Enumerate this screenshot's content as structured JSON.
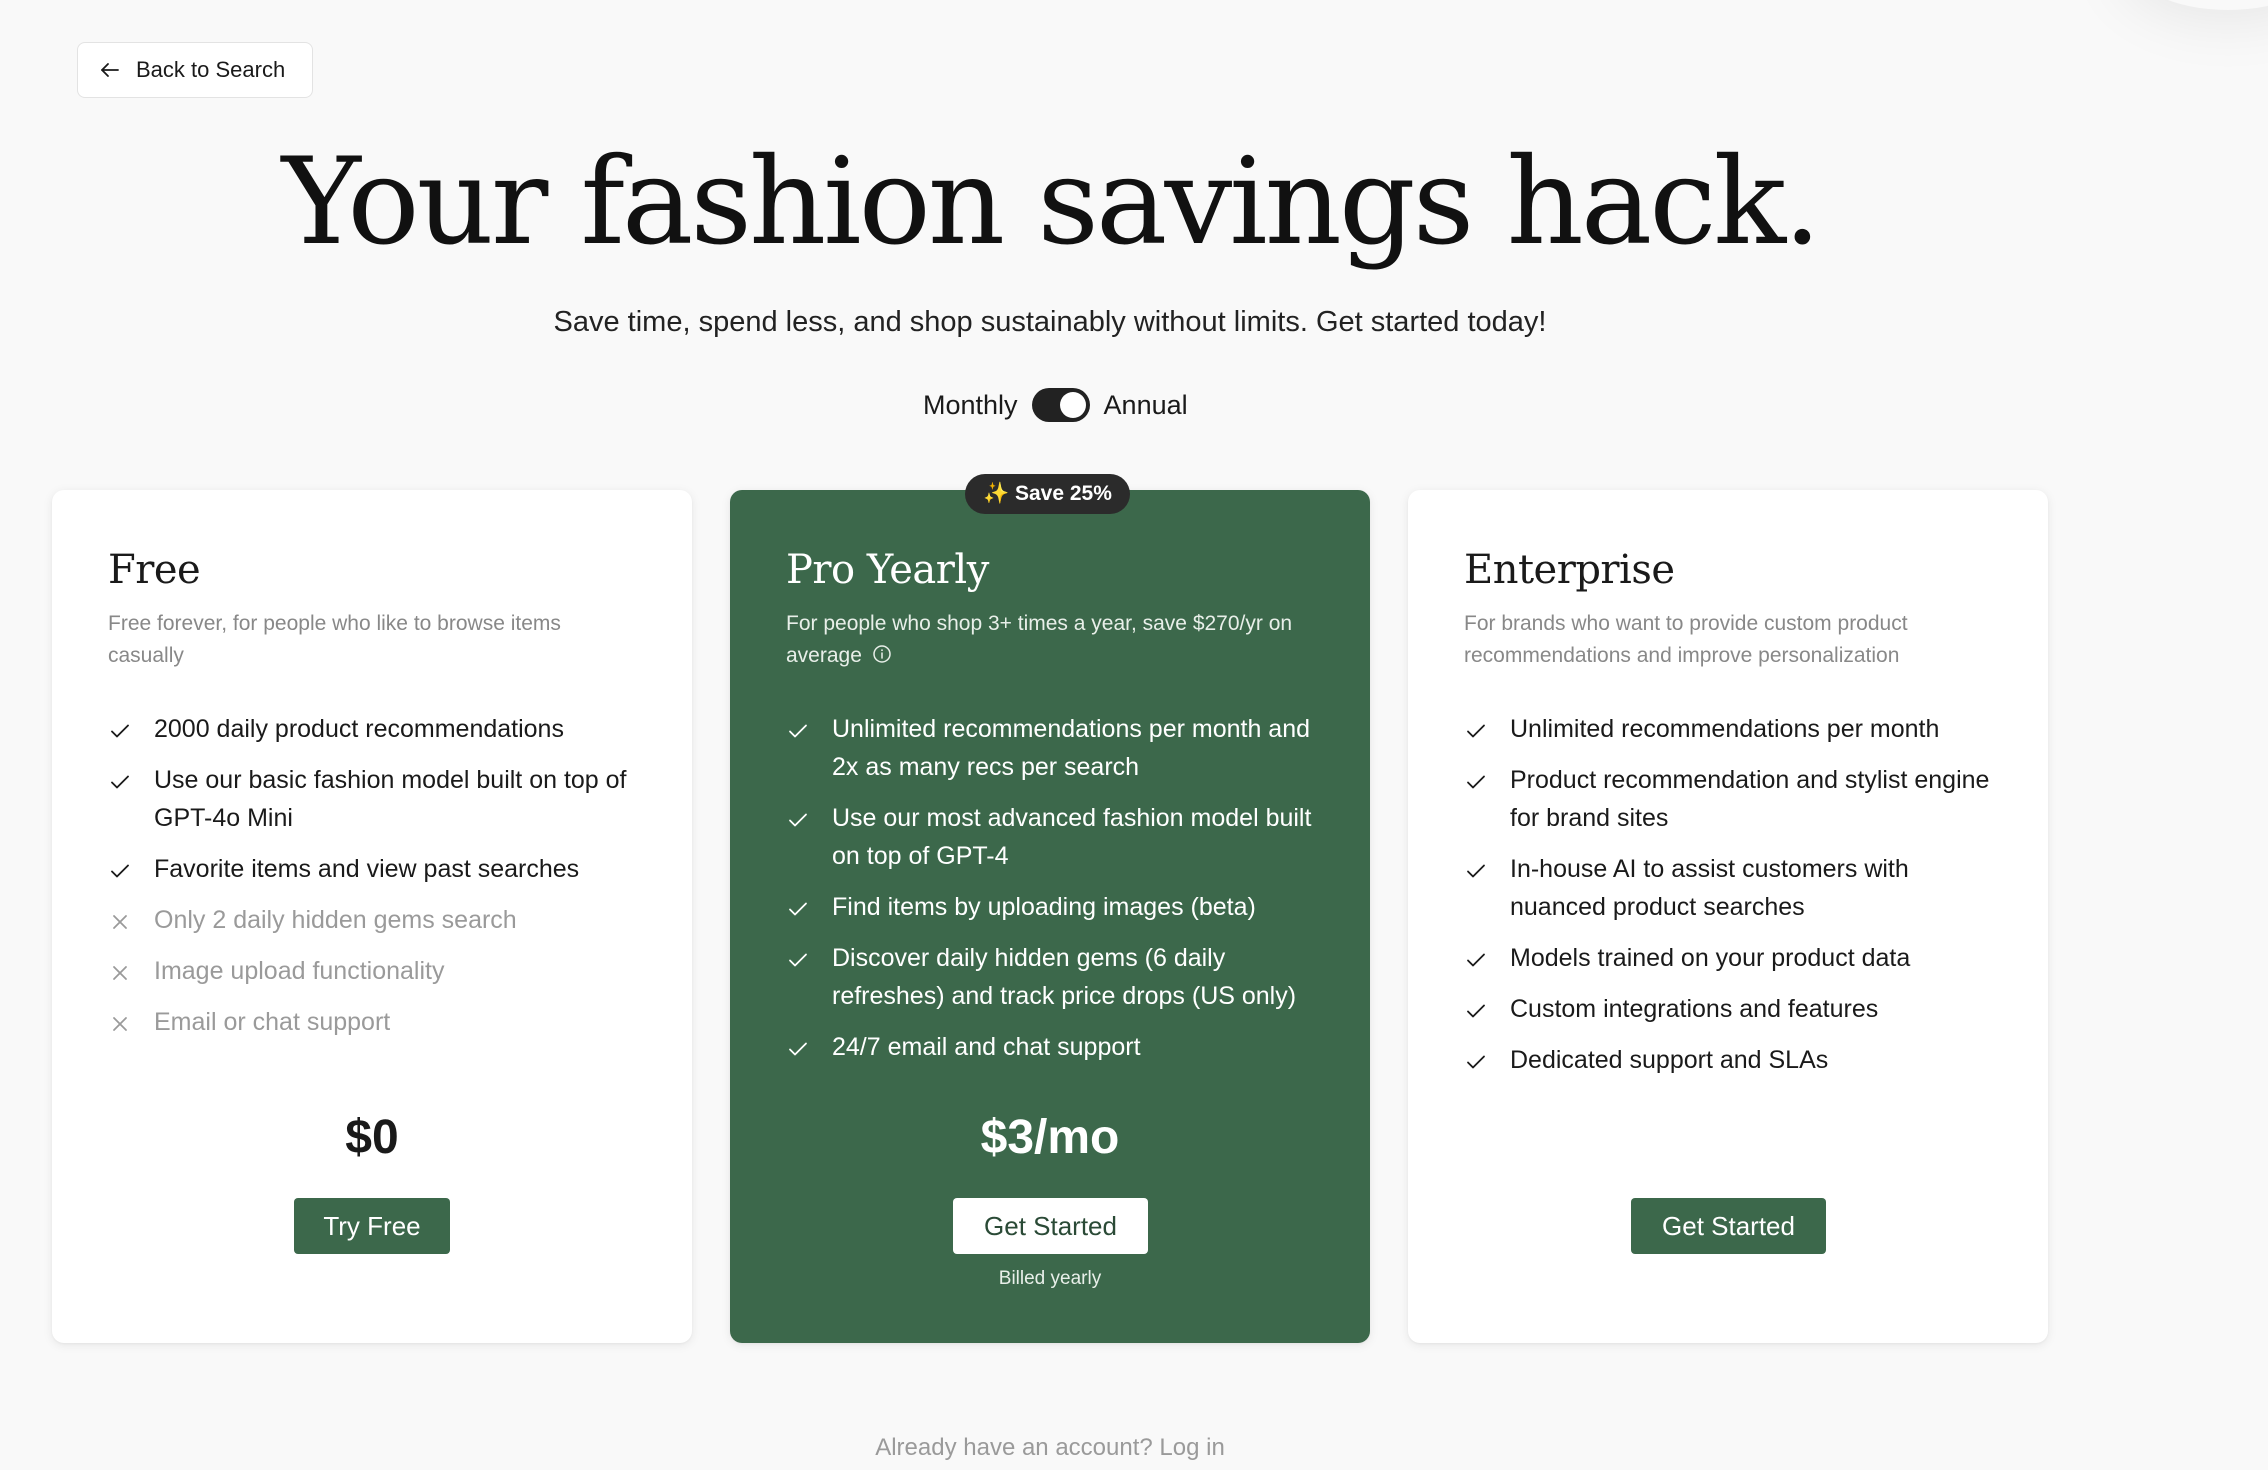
{
  "nav": {
    "back_label": "Back to Search"
  },
  "hero": {
    "title": "Your fashion savings hack.",
    "subtitle": "Save time, spend less, and shop sustainably without limits. Get started today!"
  },
  "billing": {
    "monthly_label": "Monthly",
    "annual_label": "Annual",
    "selected": "Annual"
  },
  "plans": [
    {
      "name": "Free",
      "description": "Free forever, for people who like to browse items casually",
      "features": [
        {
          "text": "2000 daily product recommendations",
          "included": true
        },
        {
          "text": "Use our basic fashion model built on top of GPT-4o Mini",
          "included": true
        },
        {
          "text": "Favorite items and view past searches",
          "included": true
        },
        {
          "text": "Only 2 daily hidden gems search",
          "included": false
        },
        {
          "text": "Image upload functionality",
          "included": false
        },
        {
          "text": "Email or chat support",
          "included": false
        }
      ],
      "price": "$0",
      "cta": "Try Free"
    },
    {
      "name": "Pro Yearly",
      "badge": "✨ Save 25%",
      "description": "For people who shop 3+ times a year, save $270/yr on average",
      "features": [
        {
          "text": "Unlimited recommendations per month and 2x as many recs per search",
          "included": true
        },
        {
          "text": "Use our most advanced fashion model built on top of GPT-4",
          "included": true
        },
        {
          "text": "Find items by uploading images (beta)",
          "included": true
        },
        {
          "text": "Discover daily hidden gems (6 daily refreshes) and track price drops (US only)",
          "included": true
        },
        {
          "text": "24/7 email and chat support",
          "included": true
        }
      ],
      "price": "$3/mo",
      "cta": "Get Started",
      "billing_note": "Billed yearly"
    },
    {
      "name": "Enterprise",
      "description": "For brands who want to provide custom product recommendations and improve personalization",
      "features": [
        {
          "text": "Unlimited recommendations per month",
          "included": true
        },
        {
          "text": "Product recommendation and stylist engine for brand sites",
          "included": true
        },
        {
          "text": "In-house AI to assist customers with nuanced product searches",
          "included": true
        },
        {
          "text": "Models trained on your product data",
          "included": true
        },
        {
          "text": "Custom integrations and features",
          "included": true
        },
        {
          "text": "Dedicated support and SLAs",
          "included": true
        }
      ],
      "cta": "Get Started"
    }
  ],
  "footer": {
    "question": "Already have an account?",
    "login_label": "Log in"
  },
  "colors": {
    "brand_green": "#3c684b",
    "badge_dark": "#2b2b2b",
    "background": "#f9f9f9"
  },
  "icons": {
    "back": "arrow-left-icon",
    "included": "check-icon",
    "excluded": "x-icon",
    "info": "info-icon"
  }
}
